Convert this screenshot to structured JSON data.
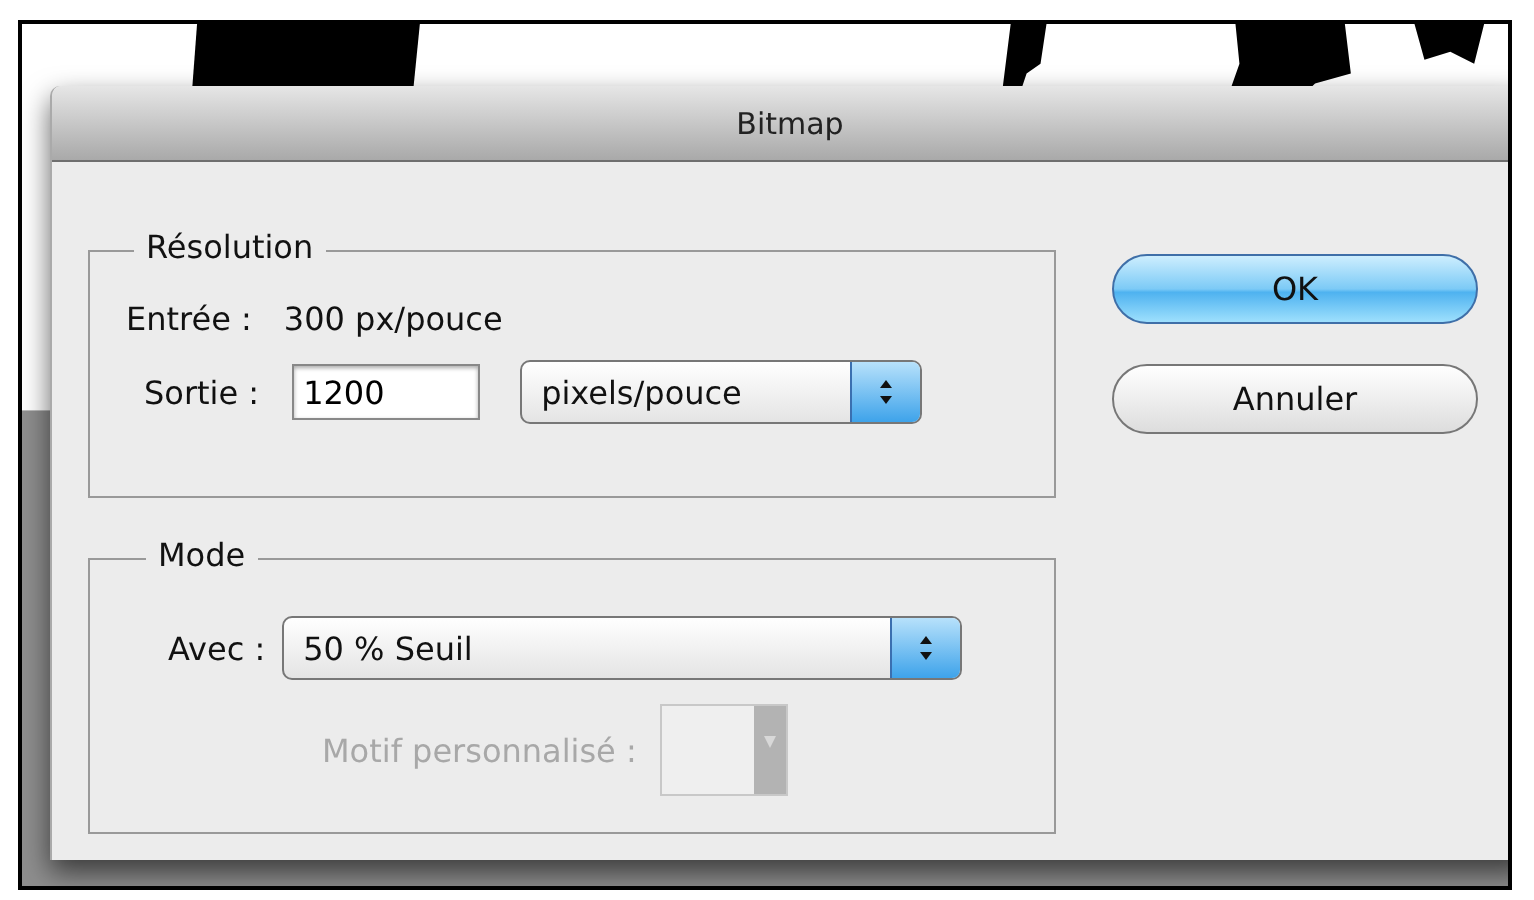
{
  "window": {
    "title": "Bitmap"
  },
  "resolution": {
    "legend": "Résolution",
    "input_label": "Entrée :",
    "input_value": "300 px/pouce",
    "output_label": "Sortie :",
    "output_value": "1200",
    "unit": "pixels/pouce"
  },
  "mode": {
    "legend": "Mode",
    "method_label": "Avec :",
    "method": "50 % Seuil",
    "pattern_label": "Motif personnalisé :",
    "pattern_disabled": true
  },
  "buttons": [
    {
      "label": "OK",
      "default": true
    },
    {
      "label": "Annuler",
      "default": false
    }
  ]
}
